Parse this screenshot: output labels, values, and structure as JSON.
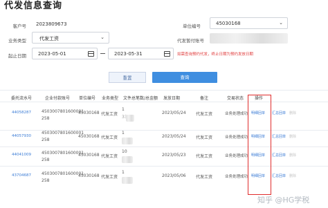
{
  "page": {
    "title": "代发信息查询"
  },
  "form": {
    "customer_no_label": "客户号",
    "customer_no": "2023809673",
    "org_code_label": "单位编号",
    "org_code": "45030168",
    "business_type_label": "业务类型",
    "business_type": "代发工资",
    "payer_account_label": "代发暂付账号",
    "start_date_label": "起止日期",
    "start_date": "2023-05-01",
    "end_date": "2023-05-31",
    "note": "如需查询预约代发，终止日期为预约发放日期",
    "reset_label": "重置",
    "query_label": "查询"
  },
  "table": {
    "headers": [
      "委托流水号",
      "企业付款账号",
      "单位编号",
      "业务类型",
      "文件总笔数/总金额",
      "发放日期",
      "备注",
      "交易状态",
      "操作"
    ],
    "rows": [
      {
        "serial": "44058287",
        "account_a": "4503007801600001",
        "account_b": "258",
        "org": "45030168",
        "type": "代发工资",
        "count": "1",
        "amount": "33",
        "date": "2023/05/24",
        "remark": "代发工资",
        "status": "业务处理成功",
        "action_1": "明细回单",
        "action_2": "汇总回单",
        "action_3": "删除"
      },
      {
        "serial": "44057930",
        "account_a": "4503007801600001",
        "account_b": "258",
        "org": "45030168",
        "type": "代发工资",
        "count": "1",
        "amount": "",
        "date": "2023/05/24",
        "remark": "代发工资",
        "status": "业务处理成功",
        "action_1": "明细回单",
        "action_2": "汇总回单",
        "action_3": "删除"
      },
      {
        "serial": "44041009",
        "account_a": "4503007801600001",
        "account_b": "258",
        "org": "45030168",
        "type": "代发工资",
        "count": "10",
        "amount": "",
        "date": "2023/05/23",
        "remark": "代发工资",
        "status": "业务处理成功",
        "action_1": "明细回单",
        "action_2": "汇总回单",
        "action_3": "删除"
      },
      {
        "serial": "43704687",
        "account_a": "4503007801600001",
        "account_b": "258",
        "org": "45030168",
        "type": "代发工资",
        "count": "1",
        "amount": "",
        "date": "2023/05/06",
        "remark": "代发工资",
        "status": "业务处理成功",
        "action_1": "明细回单",
        "action_2": "汇总回单",
        "action_3": "删除"
      }
    ]
  },
  "watermark": "知乎 @HG学税",
  "colors": {
    "accent": "#3f8ee0",
    "link": "#3a7bd5",
    "highlight": "#e02b2b",
    "note": "#e03c3c"
  }
}
